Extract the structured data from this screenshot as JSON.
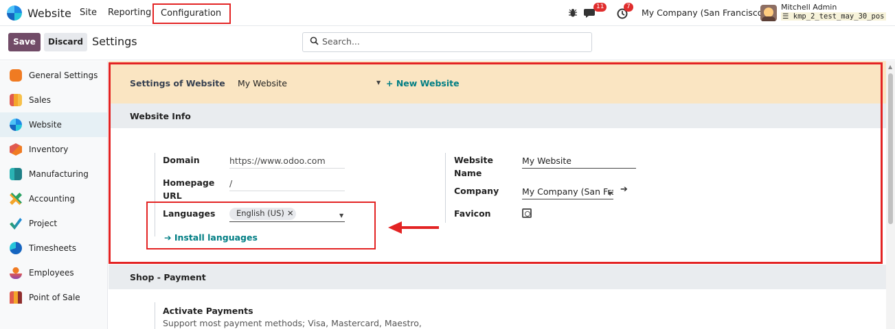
{
  "topbar": {
    "app_name": "Website",
    "menu": [
      "Site",
      "Reporting",
      "Configuration"
    ],
    "chat_count": "11",
    "activity_count": "7",
    "company": "My Company (San Francisco)",
    "user_name": "Mitchell Admin",
    "database": "kmp_2_test_may_30_pos"
  },
  "control_panel": {
    "save_label": "Save",
    "discard_label": "Discard",
    "title": "Settings",
    "search_placeholder": "Search..."
  },
  "sidebar": {
    "items": [
      {
        "label": "General Settings",
        "color": "#f07b22"
      },
      {
        "label": "Sales",
        "color": "#f4a52a"
      },
      {
        "label": "Website",
        "color": "#1e88e5"
      },
      {
        "label": "Inventory",
        "color": "#e05a4f"
      },
      {
        "label": "Manufacturing",
        "color": "#2ab3b3"
      },
      {
        "label": "Accounting",
        "color": "#f4a52a"
      },
      {
        "label": "Project",
        "color": "#2aa163"
      },
      {
        "label": "Timesheets",
        "color": "#1565c0"
      },
      {
        "label": "Employees",
        "color": "#f07b22"
      },
      {
        "label": "Point of Sale",
        "color": "#e05a4f"
      }
    ],
    "active_index": 2
  },
  "website_settings": {
    "label": "Settings of Website",
    "selected_website": "My Website",
    "new_website_label": "+ New Website"
  },
  "website_info": {
    "section_title": "Website Info",
    "domain_label": "Domain",
    "domain_value": "https://www.odoo.com",
    "homepage_label_1": "Homepage",
    "homepage_label_2": "URL",
    "homepage_value": "/",
    "languages_label": "Languages",
    "language_tag": "English (US)",
    "install_languages_label": "➔ Install languages",
    "website_name_label_1": "Website",
    "website_name_label_2": "Name",
    "website_name_value": "My Website",
    "company_label": "Company",
    "company_value": "My Company (San Frar",
    "favicon_label": "Favicon"
  },
  "shop_payment": {
    "section_title": "Shop - Payment",
    "activate_payments_title": "Activate Payments",
    "activate_payments_desc": "Support most payment methods; Visa, Mastercard, Maestro,"
  },
  "annotation_color": "#e32323",
  "accent_color": "#714b67",
  "link_color": "#017e84"
}
